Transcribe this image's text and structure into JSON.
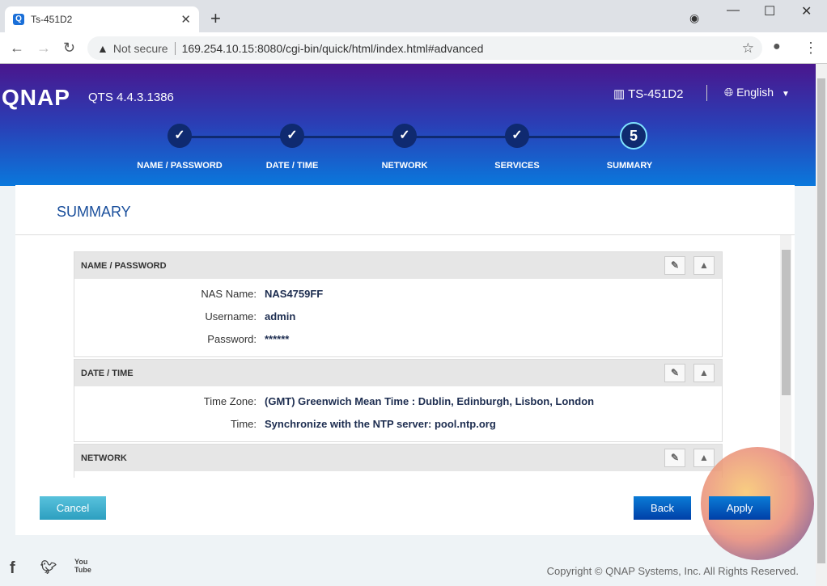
{
  "browser": {
    "tab_title": "Ts-451D2",
    "tab_favicon": "Q",
    "not_secure": "Not secure",
    "url": "169.254.10.15:8080/cgi-bin/quick/html/index.html#advanced"
  },
  "header": {
    "logo": "QNAP",
    "version": "QTS 4.4.3.1386",
    "model": "TS-451D2",
    "language": "English"
  },
  "steps": [
    {
      "label": "NAME / PASSWORD",
      "mark": "✓"
    },
    {
      "label": "DATE / TIME",
      "mark": "✓"
    },
    {
      "label": "NETWORK",
      "mark": "✓"
    },
    {
      "label": "SERVICES",
      "mark": "✓"
    },
    {
      "label": "SUMMARY",
      "mark": "5"
    }
  ],
  "summary": {
    "title": "SUMMARY",
    "sections": [
      {
        "title": "NAME / PASSWORD",
        "rows": [
          {
            "k": "NAS Name:",
            "v": "NAS4759FF"
          },
          {
            "k": "Username:",
            "v": "admin"
          },
          {
            "k": "Password:",
            "v": "******"
          }
        ]
      },
      {
        "title": "DATE / TIME",
        "rows": [
          {
            "k": "Time Zone:",
            "v": "(GMT) Greenwich Mean Time : Dublin, Edinburgh, Lisbon, London"
          },
          {
            "k": "Time:",
            "v": "Synchronize with the NTP server: pool.ntp.org"
          }
        ]
      },
      {
        "title": "NETWORK"
      }
    ]
  },
  "buttons": {
    "cancel": "Cancel",
    "back": "Back",
    "apply": "Apply"
  },
  "footer": {
    "copyright": "Copyright © QNAP Systems, Inc. All Rights Reserved.",
    "youtube": "You Tube"
  }
}
